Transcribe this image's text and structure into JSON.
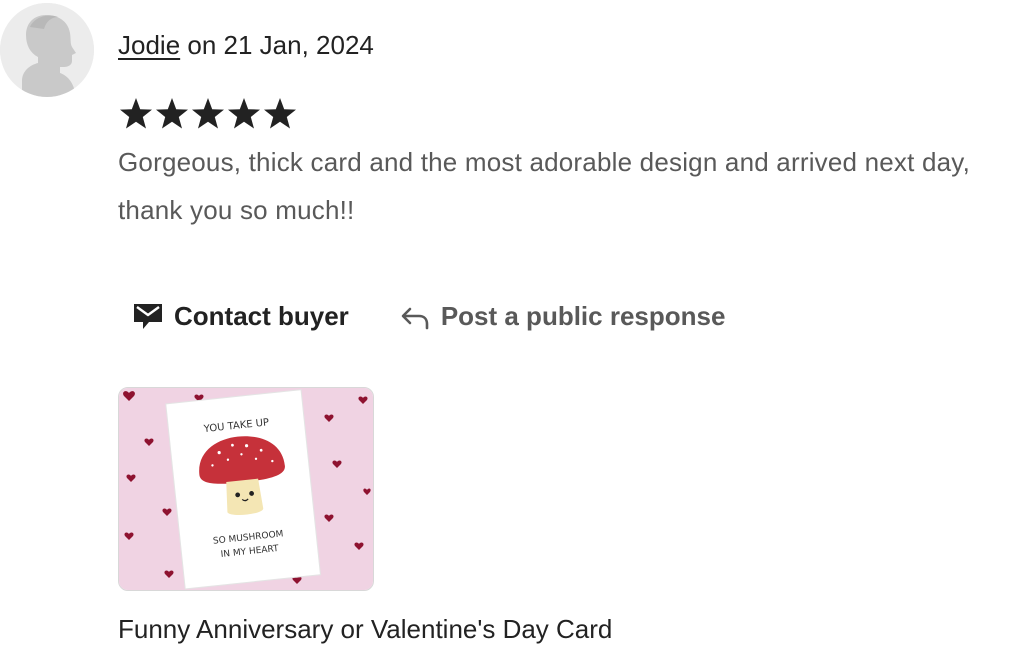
{
  "review": {
    "reviewer_name": "Jodie",
    "date_text": "on 21 Jan, 2024",
    "rating": 5,
    "rating_max": 5,
    "text": "Gorgeous, thick card and the most adorable design and arrived next day, thank you so much!!"
  },
  "actions": {
    "contact_label": "Contact buyer",
    "respond_label": "Post a public response"
  },
  "product": {
    "title": "Funny Anniversary or Valentine's Day Card",
    "image_text_top": "YOU TAKE UP",
    "image_text_bottom_1": "SO MUSHROOM",
    "image_text_bottom_2": "IN MY HEART"
  },
  "colors": {
    "text_primary": "#222222",
    "text_secondary": "#595959",
    "star": "#222222",
    "card_background": "#f0d3e3",
    "heart": "#8e1230",
    "mushroom_cap": "#c6313a"
  },
  "icons": {
    "avatar": "default-user-silhouette",
    "star": "star-icon",
    "contact": "envelope-message-icon",
    "respond": "reply-arrow-icon"
  }
}
